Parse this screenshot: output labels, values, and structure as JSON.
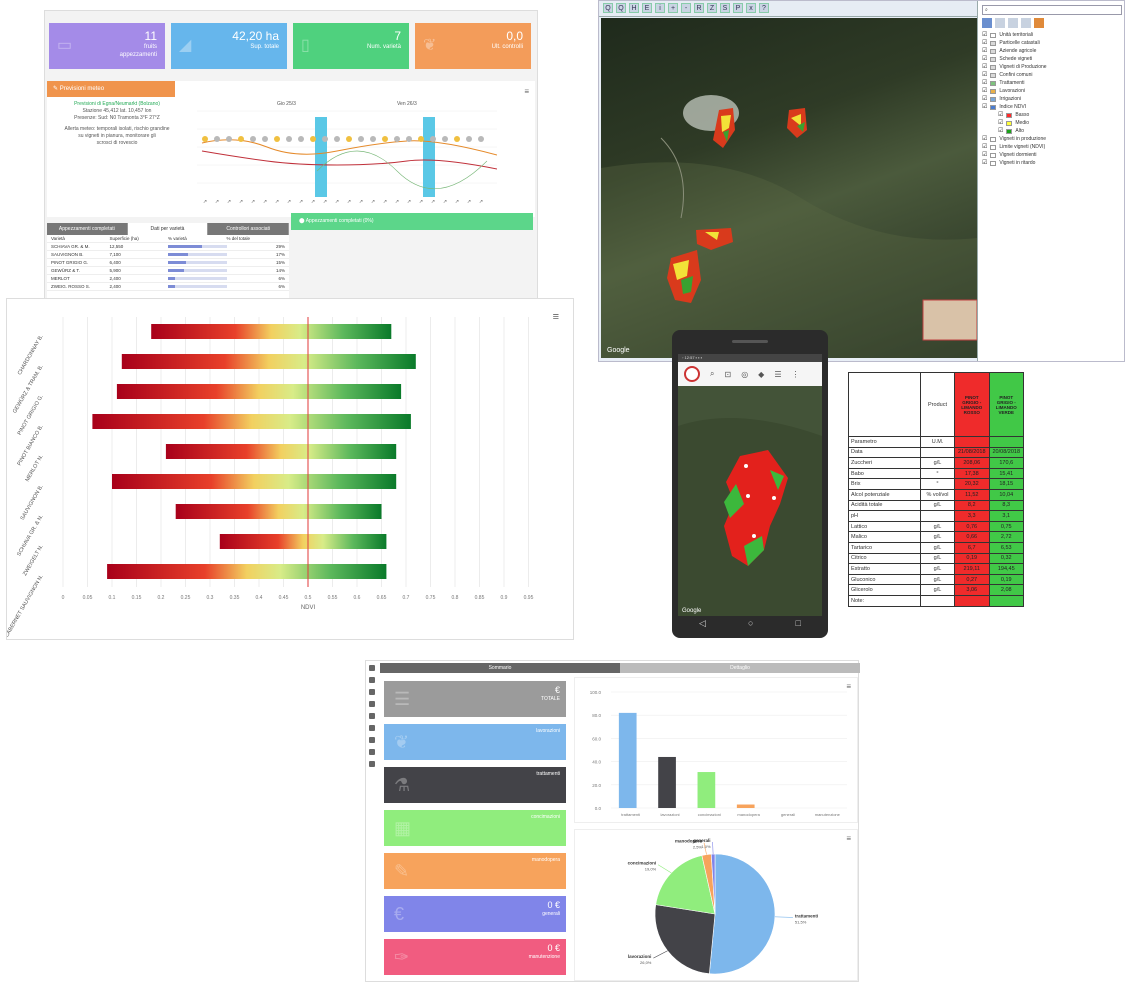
{
  "dashboard": {
    "cards": [
      {
        "value": "11",
        "label": "fruits\nappezzamenti",
        "color": "#a48be8",
        "icon": "map-icon"
      },
      {
        "value": "42,20 ha",
        "label": "Sup. totale",
        "color": "#66b6ec",
        "icon": "area-chart-icon"
      },
      {
        "value": "7",
        "label": "Num. varietà",
        "color": "#4fd17e",
        "icon": "document-icon"
      },
      {
        "value": "0,0",
        "label": "Ult. controlli",
        "color": "#f39c5a",
        "icon": "leaf-icon"
      }
    ],
    "weather": {
      "title": "Previsioni meteo",
      "info": [
        "Previsioni di Egna/Neumarkt (Bolzano)",
        "Stazione 45,412 lat. 10,457 lon",
        "Presenze: Sud: N0 Tramonta 3°F 27°Z",
        "Allerta meteo: temporali isolati, rischio grandine",
        "su vigneti in pianura, monitorare gli",
        "scrosci di rovescio"
      ],
      "chart_labels": [
        "Gio 25/3",
        "Ven 26/3"
      ]
    },
    "table": {
      "tabs": [
        "Appezzamenti completati",
        "Dati per varietà",
        "Controllori associati"
      ],
      "active_tab": 1,
      "headers": [
        "Varietà",
        "Superficie (ha)",
        "% varietà",
        "% del totale"
      ],
      "rows": [
        {
          "name": "SCHIAVA GR. & M.",
          "sup": "12,550",
          "pct": 29,
          "tot": "29%"
        },
        {
          "name": "SAUVIGNON B.",
          "sup": "7,100",
          "pct": 17,
          "tot": "17%"
        },
        {
          "name": "PINOT GRIGIO G.",
          "sup": "6,400",
          "pct": 15,
          "tot": "15%"
        },
        {
          "name": "GEWÜRZ & T.",
          "sup": "5,900",
          "pct": 14,
          "tot": "14%"
        },
        {
          "name": "MERLOT",
          "sup": "2,400",
          "pct": 6,
          "tot": "6%"
        },
        {
          "name": "ZWEIG. ROSSO S.",
          "sup": "2,400",
          "pct": 6,
          "tot": "6%"
        }
      ]
    },
    "status": "Appezzamenti completati (0%)"
  },
  "gis": {
    "toolbar": [
      "Q",
      "Q",
      "H",
      "E",
      "i",
      "+",
      "-",
      "R",
      "Z",
      "S",
      "P",
      "x",
      "?"
    ],
    "layers": [
      {
        "name": "Unità territoriali",
        "color": "#ffffff"
      },
      {
        "name": "Particelle catastali",
        "color": "#d9d9d9"
      },
      {
        "name": "Aziende agricole",
        "color": "#d9d9d9"
      },
      {
        "name": "Schede vigneti",
        "color": "#d9d9d9"
      },
      {
        "name": "Vigneti di Produzione",
        "color": "#d9d9d9"
      },
      {
        "name": "Confini comuni",
        "color": "#d9d9d9"
      },
      {
        "name": "Trattamenti",
        "color": "#7ec27e"
      },
      {
        "name": "Lavorazioni",
        "color": "#e8b04a"
      },
      {
        "name": "Irrigazioni",
        "color": "#7aa8d8"
      },
      {
        "name": "Indice NDVI",
        "color": "#4a7cd0"
      },
      {
        "name": "Basso",
        "color": "#ff2a2a"
      },
      {
        "name": "Medio",
        "color": "#ffff3a"
      },
      {
        "name": "Alto",
        "color": "#1aa31a"
      },
      {
        "name": "Vigneti in produzione",
        "color": "#ffffff"
      },
      {
        "name": "Limite vigneti (NDVI)",
        "color": "#ffffff"
      },
      {
        "name": "Vigneti dormienti",
        "color": "#ffffff"
      },
      {
        "name": "Vigneti in ritardo",
        "color": "#ffffff"
      }
    ],
    "google_label": "Google"
  },
  "chart_data": [
    {
      "type": "bar",
      "title": "",
      "xlabel": "NDVI",
      "ylabel": "",
      "xlim": [
        0,
        1
      ],
      "reference_line": 0.5,
      "categories": [
        "CHARDONNAY B.",
        "GEWÜRZ & TRAM. B.",
        "PINOT GRIGIO G.",
        "PINOT BIANCO B.",
        "MERLOT N.",
        "SAUVIGNON B.",
        "SCHIAVA GR. & N.",
        "ZWEIGELT N.",
        "CABERNET SAUVIGNON N."
      ],
      "ranges": [
        [
          0.18,
          0.67
        ],
        [
          0.12,
          0.72
        ],
        [
          0.11,
          0.69
        ],
        [
          0.06,
          0.71
        ],
        [
          0.21,
          0.68
        ],
        [
          0.1,
          0.68
        ],
        [
          0.23,
          0.65
        ],
        [
          0.32,
          0.66
        ],
        [
          0.09,
          0.66
        ]
      ],
      "ticks": [
        "0",
        "0.05",
        "0.1",
        "0.15",
        "0.2",
        "0.25",
        "0.3",
        "0.35",
        "0.4",
        "0.45",
        "0.5",
        "0.55",
        "0.6",
        "0.65",
        "0.7",
        "0.75",
        "0.8",
        "0.85",
        "0.9",
        "0.95"
      ]
    },
    {
      "type": "bar",
      "title": "",
      "xlabel": "",
      "ylabel": "",
      "ylim": [
        0,
        100
      ],
      "categories": [
        "trattamenti",
        "lavorazioni",
        "concimazioni",
        "manodopera",
        "generali",
        "manutenzione"
      ],
      "values": [
        82,
        44,
        31,
        3,
        0,
        0
      ],
      "colors": [
        "#7db7ec",
        "#434348",
        "#90ed7d",
        "#f7a35c",
        "#8085e9",
        "#f15c80"
      ],
      "ytick_labels": [
        "0.0",
        "20.0",
        "40.0",
        "60.0",
        "80.0",
        "100.0"
      ]
    },
    {
      "type": "pie",
      "slices": [
        {
          "name": "trattamenti",
          "pct": 51.5,
          "color": "#7db7ec"
        },
        {
          "name": "lavorazioni",
          "pct": 26.0,
          "color": "#434348"
        },
        {
          "name": "concimazioni",
          "pct": 19.0,
          "color": "#90ed7d"
        },
        {
          "name": "manodopera",
          "pct": 2.5,
          "color": "#f7a35c"
        },
        {
          "name": "generali",
          "pct": 1.0,
          "color": "#8085e9"
        }
      ]
    }
  ],
  "phone": {
    "status": "◦ 12:57 ▪ ▪ ▪",
    "toolbar_icons": [
      "search-icon",
      "scan-icon",
      "target-icon",
      "layers-icon",
      "menu-icon",
      "more-icon"
    ],
    "google_label": "Google",
    "nav": [
      "◁",
      "○",
      "□"
    ]
  },
  "data_table": {
    "header": [
      "",
      "Product",
      "PINOT GRIGIO - LIMANDO ROSSO",
      "PINOT GRIGIO - LIMANDO VERDE"
    ],
    "rows": [
      [
        "Parametro",
        "U.M.",
        "",
        ""
      ],
      [
        "Data",
        "",
        "21/08/2018",
        "20/08/2018"
      ],
      [
        "Zuccheri",
        "g/L",
        "208,06",
        "170,6"
      ],
      [
        "Babo",
        "°",
        "17,38",
        "15,41"
      ],
      [
        "Brix",
        "°",
        "20,32",
        "18,15"
      ],
      [
        "Alcol potenziale",
        "% vol/vol",
        "11,52",
        "10,04"
      ],
      [
        "Acidità totale",
        "g/L",
        "8,2",
        "8,3"
      ],
      [
        "pH",
        "",
        "3,3",
        "3,1"
      ],
      [
        "Lattico",
        "g/L",
        "0,76",
        "0,75"
      ],
      [
        "Malico",
        "g/L",
        "0,66",
        "2,72"
      ],
      [
        "Tartarico",
        "g/L",
        "6,7",
        "6,53"
      ],
      [
        "Citrico",
        "g/L",
        "0,19",
        "0,32"
      ],
      [
        "Estratto",
        "g/L",
        "219,11",
        "194,45"
      ],
      [
        "Gluconico",
        "g/L",
        "0,27",
        "0,19"
      ],
      [
        "Glicerolo",
        "g/L",
        "3,06",
        "2,08"
      ],
      [
        "Note:",
        "",
        "",
        ""
      ]
    ]
  },
  "costs": {
    "tabs": [
      "Sommario",
      "Dettaglio"
    ],
    "cards": [
      {
        "value": "€",
        "label": "TOTALE",
        "color": "#9b9b9b",
        "icon": "list-icon"
      },
      {
        "value": "",
        "label": "lavorazioni",
        "color": "#7db7ec",
        "icon": "leaf-icon"
      },
      {
        "value": "",
        "label": "trattamenti",
        "color": "#434348",
        "icon": "flask-icon"
      },
      {
        "value": "",
        "label": "concimazioni",
        "color": "#90ed7d",
        "icon": "fertilizer-icon"
      },
      {
        "value": "",
        "label": "manodopera",
        "color": "#f7a35c",
        "icon": "tool-icon"
      },
      {
        "value": "0 €",
        "label": "generali",
        "color": "#8085e9",
        "icon": "euro-icon"
      },
      {
        "value": "0 €",
        "label": "manutenzione",
        "color": "#f15c80",
        "icon": "wrench-icon"
      }
    ]
  }
}
